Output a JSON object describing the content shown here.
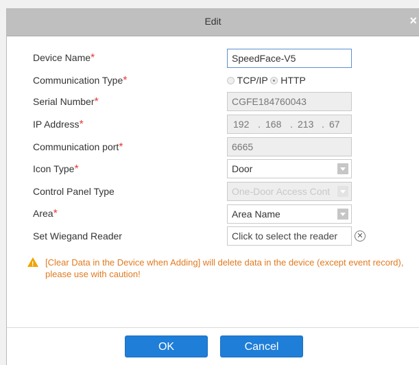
{
  "dialog": {
    "title": "Edit",
    "close_icon": "close-icon"
  },
  "fields": {
    "device_name": {
      "label": "Device Name",
      "required_mark": "*",
      "value": "SpeedFace-V5"
    },
    "communication_type": {
      "label": "Communication Type",
      "required_mark": "*",
      "options": [
        "TCP/IP",
        "HTTP"
      ],
      "selected": "HTTP"
    },
    "serial_number": {
      "label": "Serial Number",
      "required_mark": "*",
      "value": "CGFE184760043"
    },
    "ip_address": {
      "label": "IP Address",
      "required_mark": "*",
      "octets": [
        "192",
        "168",
        "213",
        "67"
      ],
      "dot": "."
    },
    "communication_port": {
      "label": "Communication port",
      "required_mark": "*",
      "value": "6665"
    },
    "icon_type": {
      "label": "Icon Type",
      "required_mark": "*",
      "value": "Door"
    },
    "control_panel_type": {
      "label": "Control Panel Type",
      "value": "One-Door Access Cont"
    },
    "area": {
      "label": "Area",
      "required_mark": "*",
      "value": "Area Name"
    },
    "wiegand_reader": {
      "label": "Set Wiegand Reader",
      "placeholder": "Click to select the reader",
      "clear_symbol": "⊗"
    }
  },
  "warning": {
    "icon": "warning-icon",
    "text": "[Clear Data in the Device when Adding] will delete data in the device (except event record), please use with caution!"
  },
  "buttons": {
    "ok": "OK",
    "cancel": "Cancel"
  },
  "colors": {
    "accent": "#1f7ed8",
    "required": "#e53935",
    "warning_text": "#e07a1f",
    "warning_icon": "#f0a400"
  }
}
